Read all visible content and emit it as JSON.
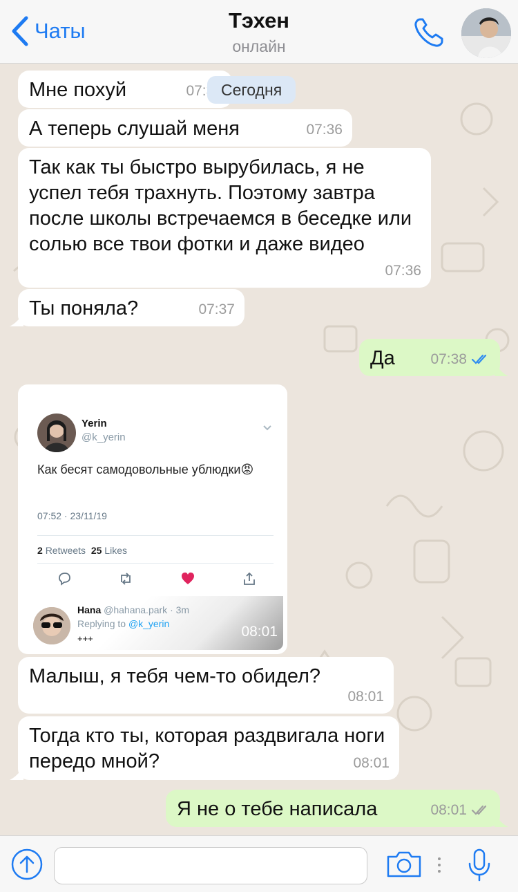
{
  "header": {
    "back_label": "Чаты",
    "contact_name": "Тэхен",
    "contact_status": "онлайн",
    "accent_color": "#1e7bf2"
  },
  "chat": {
    "date_pill": "Сегодня",
    "messages": [
      {
        "dir": "in",
        "text": "Мне похуй",
        "time": "07:36"
      },
      {
        "dir": "in",
        "text": "А теперь слушай меня",
        "time": "07:36"
      },
      {
        "dir": "in",
        "text": "Так как ты быстро вырубилась, я не успел тебя трахнуть. Поэтому завтра после школы встречаемся в беседке или солью все твои фотки и даже видео",
        "time": "07:36"
      },
      {
        "dir": "in",
        "text": "Ты поняла?",
        "time": "07:37"
      },
      {
        "dir": "out",
        "text": "Да",
        "time": "07:38",
        "status": "read"
      },
      {
        "dir": "in",
        "text": "Малыш, я тебя чем-то обидел?",
        "time": "08:01"
      },
      {
        "dir": "in",
        "text": "Тогда кто ты, которая раздвигала ноги передо мной?",
        "time": "08:01"
      },
      {
        "dir": "out",
        "text": "Я не о тебе написала",
        "time": "08:01",
        "status": "delivered"
      }
    ],
    "screenshot_card": {
      "time": "08:01",
      "tweet": {
        "name": "Yerin",
        "handle": "@k_yerin",
        "text": "Как бесят самодовольные ублюдки😡",
        "date": "07:52 · 23/11/19",
        "retweets_count": "2",
        "retweets_label": "Retweets",
        "likes_count": "25",
        "likes_label": "Likes"
      },
      "reply": {
        "name": "Hana",
        "handle_time": "@hahana.park · 3m",
        "replying_prefix": "Replying to",
        "replying_to": "@k_yerin",
        "text": "+++"
      }
    }
  },
  "bottom": {
    "input_placeholder": ""
  }
}
